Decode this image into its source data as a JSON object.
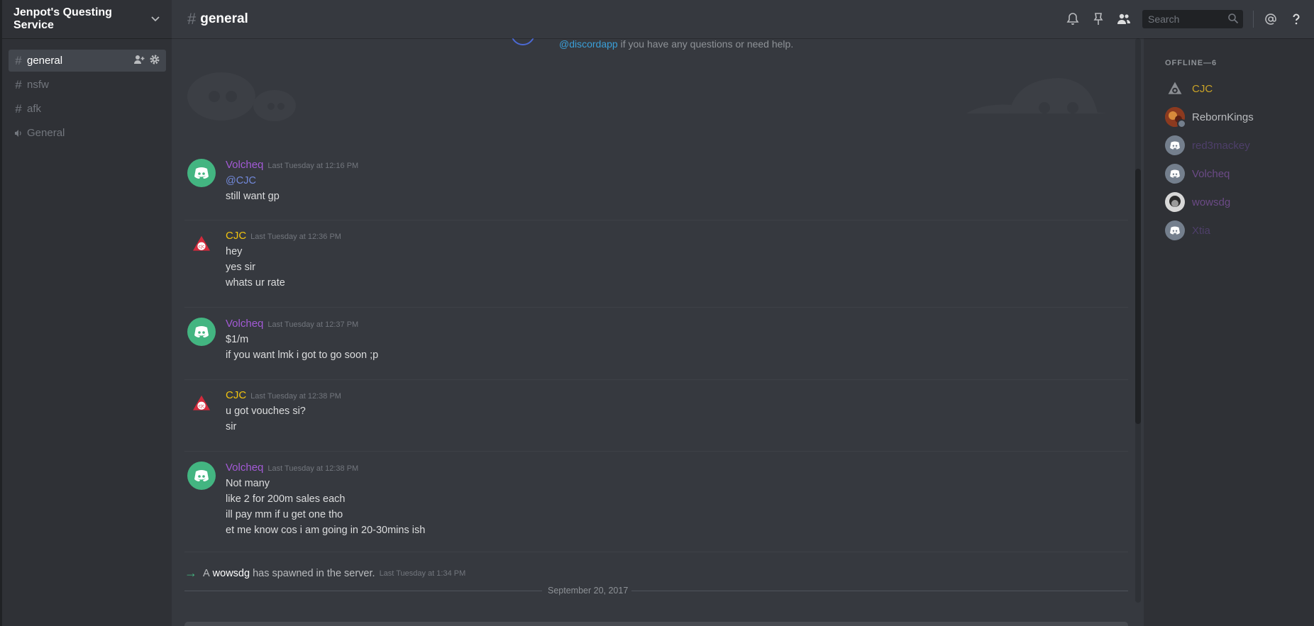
{
  "guild": {
    "name": "Jenpot's Questing Service"
  },
  "channels": [
    {
      "name": "general",
      "type": "text",
      "active": true
    },
    {
      "name": "nsfw",
      "type": "nsfw",
      "active": false
    },
    {
      "name": "afk",
      "type": "text",
      "active": false
    },
    {
      "name": "General",
      "type": "voice",
      "active": false
    }
  ],
  "header": {
    "channel": "general",
    "search_placeholder": "Search"
  },
  "intro": {
    "link": "@discordapp",
    "text": "if you have any questions or need help."
  },
  "messages": [
    {
      "author": "Volcheq",
      "author_color": "#a35ad6",
      "time": "Last Tuesday at 12:16 PM",
      "avatar": "discord-green",
      "lines": [
        "@CJC",
        "still want gp"
      ]
    },
    {
      "author": "CJC",
      "author_color": "#f1c40f",
      "time": "Last Tuesday at 12:36 PM",
      "avatar": "cjc-logo",
      "lines": [
        "hey",
        "yes sir",
        "whats ur rate"
      ]
    },
    {
      "author": "Volcheq",
      "author_color": "#a35ad6",
      "time": "Last Tuesday at 12:37 PM",
      "avatar": "discord-green",
      "lines": [
        "$1/m",
        "if you want lmk i got to go soon ;p"
      ]
    },
    {
      "author": "CJC",
      "author_color": "#f1c40f",
      "time": "Last Tuesday at 12:38 PM",
      "avatar": "cjc-logo",
      "lines": [
        "u got vouches si?",
        "sir"
      ]
    },
    {
      "author": "Volcheq",
      "author_color": "#a35ad6",
      "time": "Last Tuesday at 12:38 PM",
      "avatar": "discord-green",
      "lines": [
        "Not many",
        "like 2 for 200m sales each",
        "ill pay mm if u get one tho",
        "et me know cos i am going in 20-30mins ish"
      ]
    }
  ],
  "system": {
    "prefix": "A",
    "user": "wowsdg",
    "suffix": "has spawned in the server.",
    "time": "Last Tuesday at 1:34 PM"
  },
  "date_divider": "September 20, 2017",
  "members": {
    "heading": "OFFLINE—6",
    "list": [
      {
        "name": "CJC",
        "color": "#c9a227",
        "avatar": "cjc-logo"
      },
      {
        "name": "RebornKings",
        "color": "#b9bbbe",
        "avatar": "photo"
      },
      {
        "name": "red3mackey",
        "color": "#4e3f6a",
        "avatar": "discord-grey"
      },
      {
        "name": "Volcheq",
        "color": "#6b4a86",
        "avatar": "discord-grey"
      },
      {
        "name": "wowsdg",
        "color": "#6b4a86",
        "avatar": "photo"
      },
      {
        "name": "Xtia",
        "color": "#4e3f6a",
        "avatar": "discord-grey"
      }
    ]
  }
}
